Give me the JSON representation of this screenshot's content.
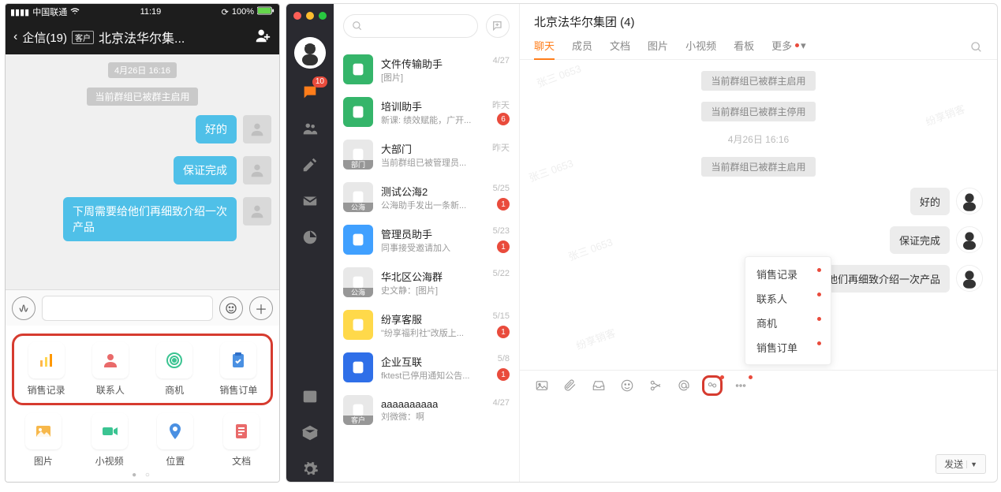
{
  "mobile": {
    "status": {
      "carrier": "中国联通",
      "time": "11:19",
      "battery": "100%"
    },
    "nav": {
      "back_label": "企信(19)",
      "tag": "客户",
      "title": "北京法华尔集..."
    },
    "chat": {
      "date_chip": "4月26日 16:16",
      "sys_chip": "当前群组已被群主启用",
      "msgs": [
        "好的",
        "保证完成",
        "下周需要给他们再细致介绍一次产品"
      ]
    },
    "tray_top": [
      {
        "label": "销售记录"
      },
      {
        "label": "联系人"
      },
      {
        "label": "商机"
      },
      {
        "label": "销售订单"
      }
    ],
    "tray_bottom": [
      {
        "label": "图片"
      },
      {
        "label": "小视频"
      },
      {
        "label": "位置"
      },
      {
        "label": "文档"
      }
    ]
  },
  "desktop": {
    "traffic": [
      "#ff5f57",
      "#febc2e",
      "#28c840"
    ],
    "nav_badge": "10",
    "conversations": [
      {
        "name": "文件传输助手",
        "sub": "[图片]",
        "date": "4/27",
        "av_bg": "#35b56a",
        "badge": "",
        "sublabel": ""
      },
      {
        "name": "培训助手",
        "sub": "新课: 绩效赋能，广开...",
        "date": "昨天",
        "av_bg": "#35b56a",
        "badge": "6",
        "sublabel": ""
      },
      {
        "name": "大部门",
        "sub": "当前群组已被管理员...",
        "date": "昨天",
        "av_bg": "#e8e8e8",
        "badge": "",
        "sublabel": "部门"
      },
      {
        "name": "测试公海2",
        "sub": "公海助手发出一条新...",
        "date": "5/25",
        "av_bg": "#e8e8e8",
        "badge": "1",
        "sublabel": "公海"
      },
      {
        "name": "管理员助手",
        "sub": "同事接受邀请加入",
        "date": "5/23",
        "av_bg": "#40a0ff",
        "badge": "1",
        "sublabel": ""
      },
      {
        "name": "华北区公海群",
        "sub": "史文静：[图片]",
        "date": "5/22",
        "av_bg": "#e8e8e8",
        "badge": "",
        "sublabel": "公海"
      },
      {
        "name": "纷享客服",
        "sub": "\"纷享福利社\"改版上...",
        "date": "5/15",
        "av_bg": "#ffd94a",
        "badge": "1",
        "sublabel": ""
      },
      {
        "name": "企业互联",
        "sub": "fktest已停用通知公告...",
        "date": "5/8",
        "av_bg": "#2f6fe8",
        "badge": "1",
        "sublabel": ""
      },
      {
        "name": "aaaaaaaaaa",
        "sub": "刘微微：啊",
        "date": "4/27",
        "av_bg": "#e8e8e8",
        "badge": "",
        "sublabel": "客户"
      }
    ],
    "header_title": "北京法华尔集团   (4)",
    "tabs": [
      "聊天",
      "成员",
      "文档",
      "图片",
      "小视频",
      "看板"
    ],
    "more_label": "更多",
    "chat": {
      "sys": [
        "当前群组已被群主启用",
        "当前群组已被群主停用"
      ],
      "date_chip": "4月26日 16:16",
      "sys2": "当前群组已被群主启用",
      "msgs": [
        "好的",
        "保证完成",
        "下周需要给他们再细致介绍一次产品"
      ]
    },
    "popup_items": [
      "销售记录",
      "联系人",
      "商机",
      "销售订单"
    ],
    "send_label": "发送"
  }
}
